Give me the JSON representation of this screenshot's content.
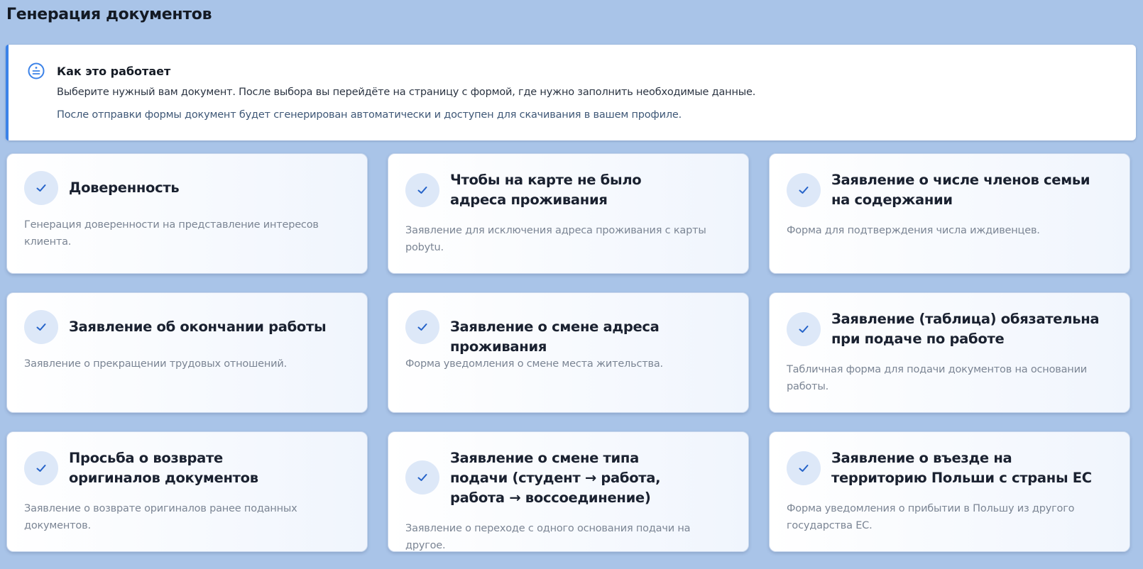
{
  "page": {
    "title": "Генерация документов"
  },
  "info": {
    "icon": "document-lines-icon",
    "title": "Как это работает",
    "line1": "Выберите нужный вам документ. После выбора вы перейдёте на страницу с формой, где нужно заполнить необходимые данные.",
    "line2": "После отправки формы документ будет сгенерирован автоматически и доступен для скачивания в вашем профиле."
  },
  "cards": [
    {
      "icon": "check-icon",
      "title": "Доверенность",
      "description": "Генерация доверенности на представление интересов клиента."
    },
    {
      "icon": "check-icon",
      "title": "Чтобы на карте не было адреса проживания",
      "description": "Заявление для исключения адреса проживания с карты pobytu."
    },
    {
      "icon": "check-icon",
      "title": "Заявление о числе членов семьи на содержании",
      "description": "Форма для подтверждения числа иждивенцев."
    },
    {
      "icon": "check-icon",
      "title": "Заявление об окончании работы",
      "description": "Заявление о прекращении трудовых отношений."
    },
    {
      "icon": "check-icon",
      "title": "Заявление о смене адреса проживания",
      "description": "Форма уведомления о смене места жительства."
    },
    {
      "icon": "check-icon",
      "title": "Заявление (таблица) обязательна при подаче по работе",
      "description": "Табличная форма для подачи документов на основании работы."
    },
    {
      "icon": "check-icon",
      "title": "Просьба о возврате оригиналов документов",
      "description": "Заявление о возврате оригиналов ранее поданных документов."
    },
    {
      "icon": "check-icon",
      "title": "Заявление о смене типа подачи (студент → работа, работа → воссоединение)",
      "description": "Заявление о переходе с одного основания подачи на другое."
    },
    {
      "icon": "check-icon",
      "title": "Заявление о въезде на территорию Польши с страны ЕС",
      "description": "Форма уведомления о прибытии в Польшу из другого государства ЕС."
    }
  ],
  "colors": {
    "accent": "#3b82e8",
    "background": "#a9c4e8",
    "check": "#2563c9"
  }
}
